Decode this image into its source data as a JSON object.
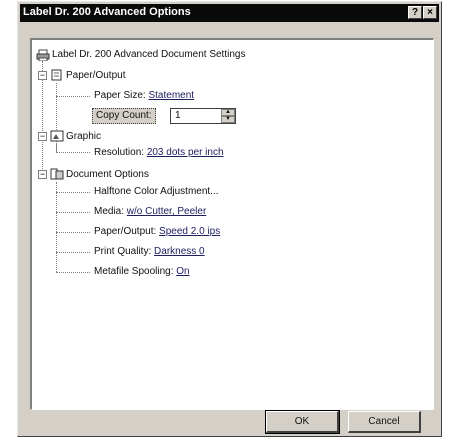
{
  "window": {
    "title": "Label Dr. 200 Advanced Options",
    "help_label": "?",
    "close_label": "×"
  },
  "tree": {
    "root": "Label Dr. 200 Advanced Document Settings",
    "paper_output": {
      "label": "Paper/Output",
      "paper_size_label": "Paper Size:",
      "paper_size_value": "Statement",
      "copy_count_label": "Copy Count:",
      "copy_count_value": "1"
    },
    "graphic": {
      "label": "Graphic",
      "resolution_label": "Resolution:",
      "resolution_value": "203 dots per inch"
    },
    "document_options": {
      "label": "Document Options",
      "halftone": "Halftone Color Adjustment...",
      "media_label": "Media:",
      "media_value": "w/o Cutter, Peeler",
      "paper_output_label": "Paper/Output:",
      "paper_output_value": "Speed 2.0 ips",
      "print_quality_label": "Print Quality:",
      "print_quality_value": "Darkness 0",
      "metafile_label": "Metafile Spooling:",
      "metafile_value": "On"
    }
  },
  "buttons": {
    "ok": "OK",
    "cancel": "Cancel"
  },
  "icons": [
    "printer-icon",
    "paper-output-icon",
    "graphic-icon",
    "document-options-icon"
  ]
}
